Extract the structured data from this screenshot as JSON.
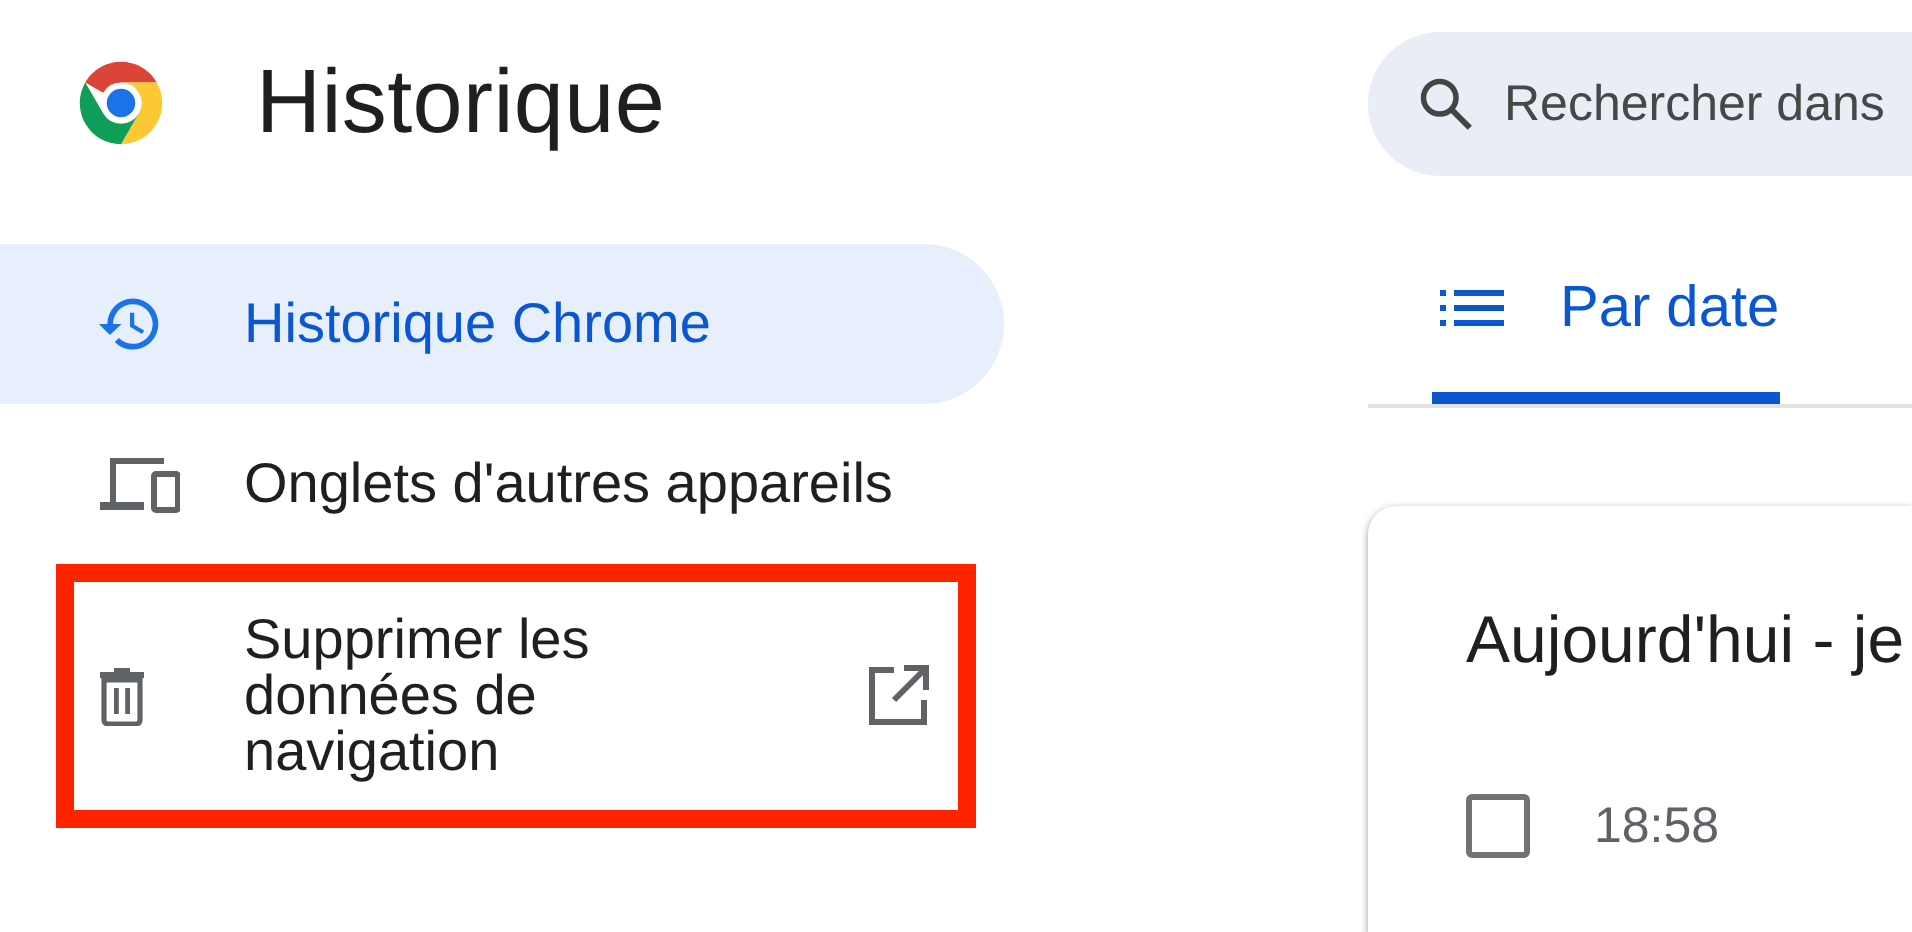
{
  "app": {
    "title": "Historique"
  },
  "search": {
    "placeholder": "Rechercher dans"
  },
  "nav": [
    {
      "kind": "history",
      "label": "Historique Chrome",
      "selected": true,
      "external": false,
      "highlighted": false
    },
    {
      "kind": "devices",
      "label": "Onglets d'autres appareils",
      "selected": false,
      "external": false,
      "highlighted": false
    },
    {
      "kind": "delete",
      "label": "Supprimer les données de navigation",
      "selected": false,
      "external": true,
      "highlighted": true
    }
  ],
  "tabs": [
    {
      "label": "Par date",
      "selected": true
    }
  ],
  "card": {
    "title": "Aujourd'hui - je",
    "rows": [
      {
        "checked": false,
        "time": "18:58"
      }
    ]
  }
}
